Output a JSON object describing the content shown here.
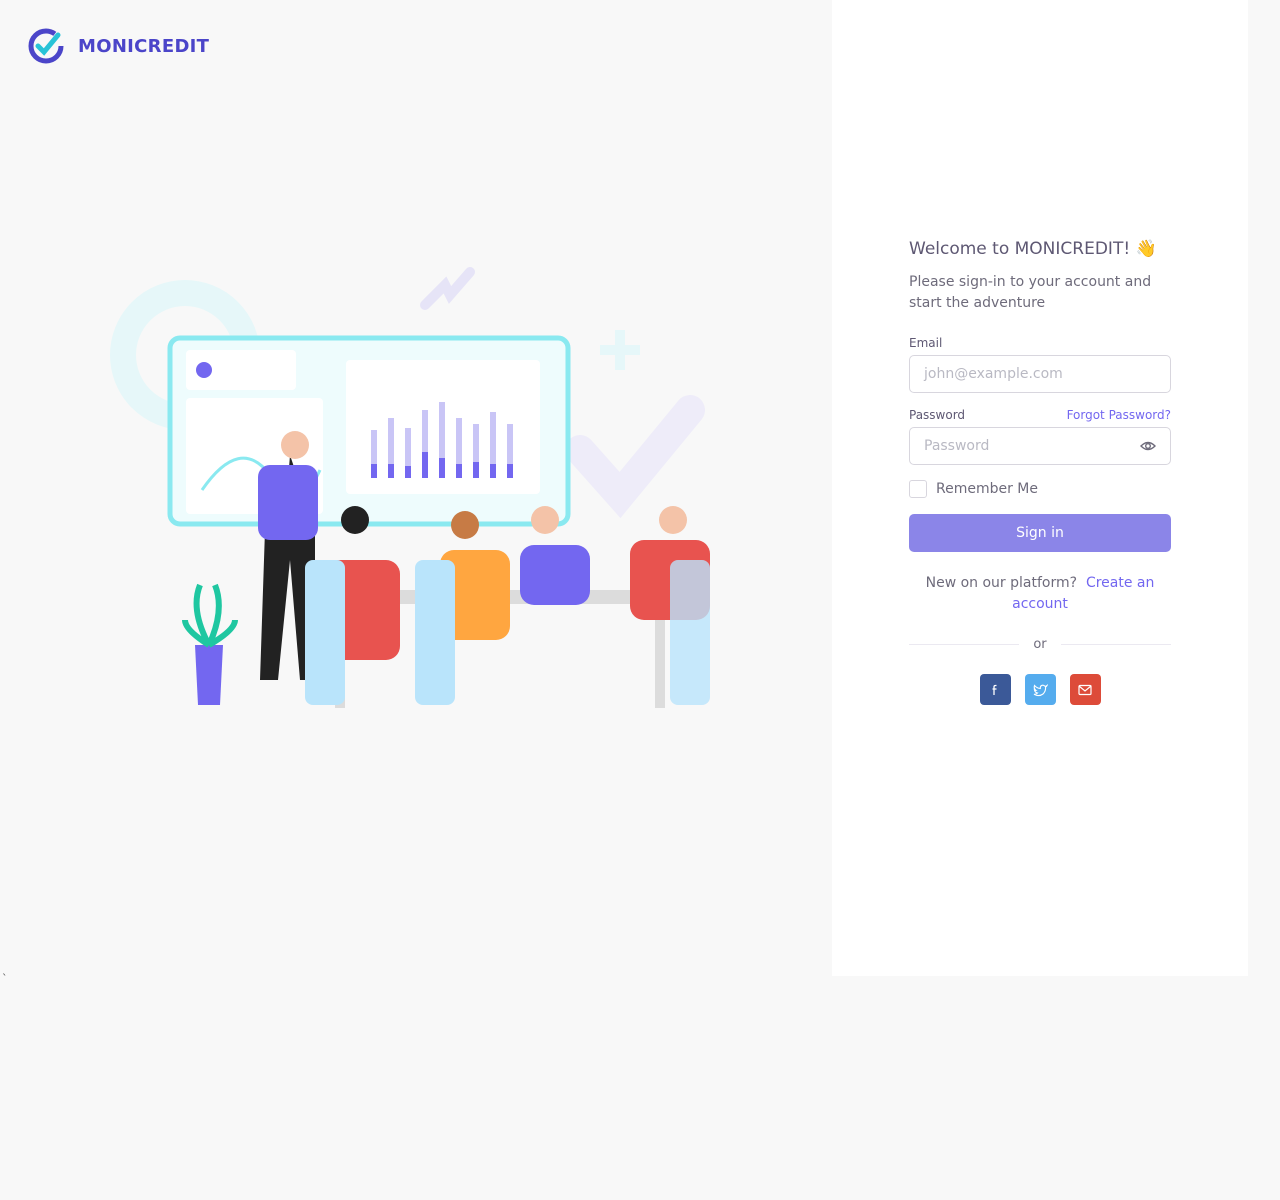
{
  "brand": {
    "name": "MONICREDIT"
  },
  "stray_char": "`",
  "login": {
    "title": "Welcome to MONICREDIT! 👋",
    "subtitle": "Please sign-in to your account and start the adventure",
    "email_label": "Email",
    "email_placeholder": "john@example.com",
    "password_label": "Password",
    "forgot_label": "Forgot Password?",
    "password_placeholder": "Password",
    "remember_label": "Remember Me",
    "signin_label": "Sign in",
    "new_text": "New on our platform?",
    "create_label": "Create an account",
    "or_label": "or"
  },
  "social": [
    {
      "icon": "facebook-icon",
      "color": "#3b5998"
    },
    {
      "icon": "twitter-icon",
      "color": "#55acee"
    },
    {
      "icon": "mail-icon",
      "color": "#dd4b39"
    }
  ],
  "colors": {
    "primary": "#7367f0",
    "brand": "#4b45c9",
    "accent": "#28c3d7"
  }
}
